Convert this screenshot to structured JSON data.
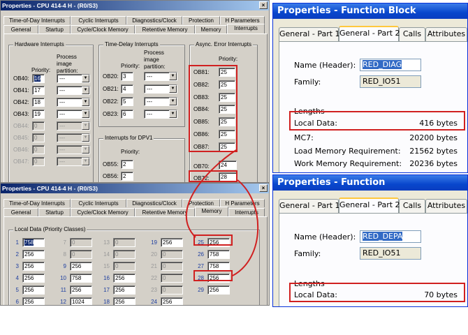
{
  "cpu_window_top": {
    "title": "Properties - CPU 414-4 H - (R0/S3)",
    "close": "×",
    "tabs_row1": [
      "Time-of-Day Interrupts",
      "Cyclic Interrupts",
      "Diagnostics/Clock",
      "Protection",
      "H Parameters"
    ],
    "tabs_row2": [
      "General",
      "Startup",
      "Cycle/Clock Memory",
      "Retentive Memory",
      "Memory",
      "Interrupts"
    ],
    "hw_group": "Hardware Interrupts",
    "hw_priority": "Priority:",
    "hw_partition": "Process image partition:",
    "hw_rows": [
      {
        "label": "OB40:",
        "prio": "16",
        "part": "---"
      },
      {
        "label": "OB41:",
        "prio": "17",
        "part": "---"
      },
      {
        "label": "OB42:",
        "prio": "18",
        "part": "---"
      },
      {
        "label": "OB43:",
        "prio": "19",
        "part": "---"
      },
      {
        "label": "OB44:",
        "prio": "0",
        "part": "---"
      },
      {
        "label": "OB45:",
        "prio": "0",
        "part": "---"
      },
      {
        "label": "OB46:",
        "prio": "0",
        "part": "---"
      },
      {
        "label": "OB47:",
        "prio": "0",
        "part": "---"
      }
    ],
    "td_group": "Time-Delay Interrupts",
    "td_priority": "Priority:",
    "td_partition": "Process image partition:",
    "td_rows": [
      {
        "label": "OB20:",
        "prio": "3",
        "part": "---"
      },
      {
        "label": "OB21:",
        "prio": "4",
        "part": "---"
      },
      {
        "label": "OB22:",
        "prio": "5",
        "part": "---"
      },
      {
        "label": "OB23:",
        "prio": "6",
        "part": "---"
      }
    ],
    "dpv1_group": "Interrupts for DPV1",
    "dpv1_priority": "Priority:",
    "dpv1_rows": [
      {
        "label": "OB55:",
        "prio": "2"
      },
      {
        "label": "OB56:",
        "prio": "2"
      }
    ],
    "async_group": "Async. Error Interrupts",
    "async_priority": "Priority:",
    "async_rows": [
      {
        "label": "OB81:",
        "prio": "25"
      },
      {
        "label": "OB82:",
        "prio": "25"
      },
      {
        "label": "OB83:",
        "prio": "25"
      },
      {
        "label": "OB84:",
        "prio": "25"
      },
      {
        "label": "OB85:",
        "prio": "25"
      },
      {
        "label": "OB86:",
        "prio": "25"
      },
      {
        "label": "OB87:",
        "prio": "25"
      }
    ],
    "ob70": {
      "label": "OB70:",
      "prio": "24"
    },
    "ob72": {
      "label": "OB72:",
      "prio": "28"
    }
  },
  "cpu_window_bottom": {
    "title": "Properties - CPU 414-4 H - (R0/S3)",
    "close": "×",
    "tabs_row1": [
      "Time-of-Day Interrupts",
      "Cyclic Interrupts",
      "Diagnostics/Clock",
      "Protection",
      "H Parameters"
    ],
    "tabs_row2": [
      "General",
      "Startup",
      "Cycle/Clock Memory",
      "Retentive Memory",
      "Memory",
      "Interrupts"
    ],
    "local_group": "Local Data (Priority Classes)",
    "columns": [
      [
        {
          "n": "1",
          "v": "758",
          "sel": true
        },
        {
          "n": "2",
          "v": "256"
        },
        {
          "n": "3",
          "v": "256"
        },
        {
          "n": "4",
          "v": "256"
        },
        {
          "n": "5",
          "v": "256"
        },
        {
          "n": "6",
          "v": "256"
        }
      ],
      [
        {
          "n": "7",
          "v": "0",
          "dis": true
        },
        {
          "n": "8",
          "v": "0",
          "dis": true
        },
        {
          "n": "9",
          "v": "256"
        },
        {
          "n": "10",
          "v": "758"
        },
        {
          "n": "11",
          "v": "256"
        },
        {
          "n": "12",
          "v": "1024"
        }
      ],
      [
        {
          "n": "13",
          "v": "0",
          "dis": true
        },
        {
          "n": "14",
          "v": "0",
          "dis": true
        },
        {
          "n": "15",
          "v": "0",
          "dis": true
        },
        {
          "n": "16",
          "v": "256"
        },
        {
          "n": "17",
          "v": "256"
        },
        {
          "n": "18",
          "v": "256"
        }
      ],
      [
        {
          "n": "19",
          "v": "256"
        },
        {
          "n": "20",
          "v": "0",
          "dis": true
        },
        {
          "n": "21",
          "v": "0",
          "dis": true
        },
        {
          "n": "22",
          "v": "0",
          "dis": true
        },
        {
          "n": "23",
          "v": "0",
          "dis": true
        },
        {
          "n": "24",
          "v": "256"
        }
      ],
      [
        {
          "n": "25",
          "v": "256"
        },
        {
          "n": "26",
          "v": "758"
        },
        {
          "n": "27",
          "v": "758"
        },
        {
          "n": "28",
          "v": "256"
        },
        {
          "n": "29",
          "v": "256"
        }
      ]
    ]
  },
  "fb_window": {
    "title": "Properties - Function Block",
    "tabs": [
      "General - Part 1",
      "General - Part 2",
      "Calls",
      "Attributes"
    ],
    "name_label": "Name (Header):",
    "name_value": "RED_DIAG",
    "family_label": "Family:",
    "family_value": "RED_IO51",
    "lengths_label": "Lengths",
    "local_label": "Local Data:",
    "local_value": "416 bytes",
    "mc7_label": "MC7:",
    "mc7_value": "20200 bytes",
    "load_label": "Load Memory Requirement:",
    "load_value": "21562 bytes",
    "work_label": "Work Memory Requirement:",
    "work_value": "20236 bytes"
  },
  "fc_window": {
    "title": "Properties - Function",
    "tabs": [
      "General - Part 1",
      "General - Part 2",
      "Calls",
      "Attributes"
    ],
    "name_label": "Name (Header):",
    "name_value": "RED_DEPA",
    "family_label": "Family:",
    "family_value": "RED_IO51",
    "lengths_label": "Lengths",
    "local_label": "Local Data:",
    "local_value": "70 bytes"
  },
  "colors": {
    "highlight_red": "#d02020",
    "xp_title": "#0846cc",
    "classic_title": "#0a246a"
  }
}
